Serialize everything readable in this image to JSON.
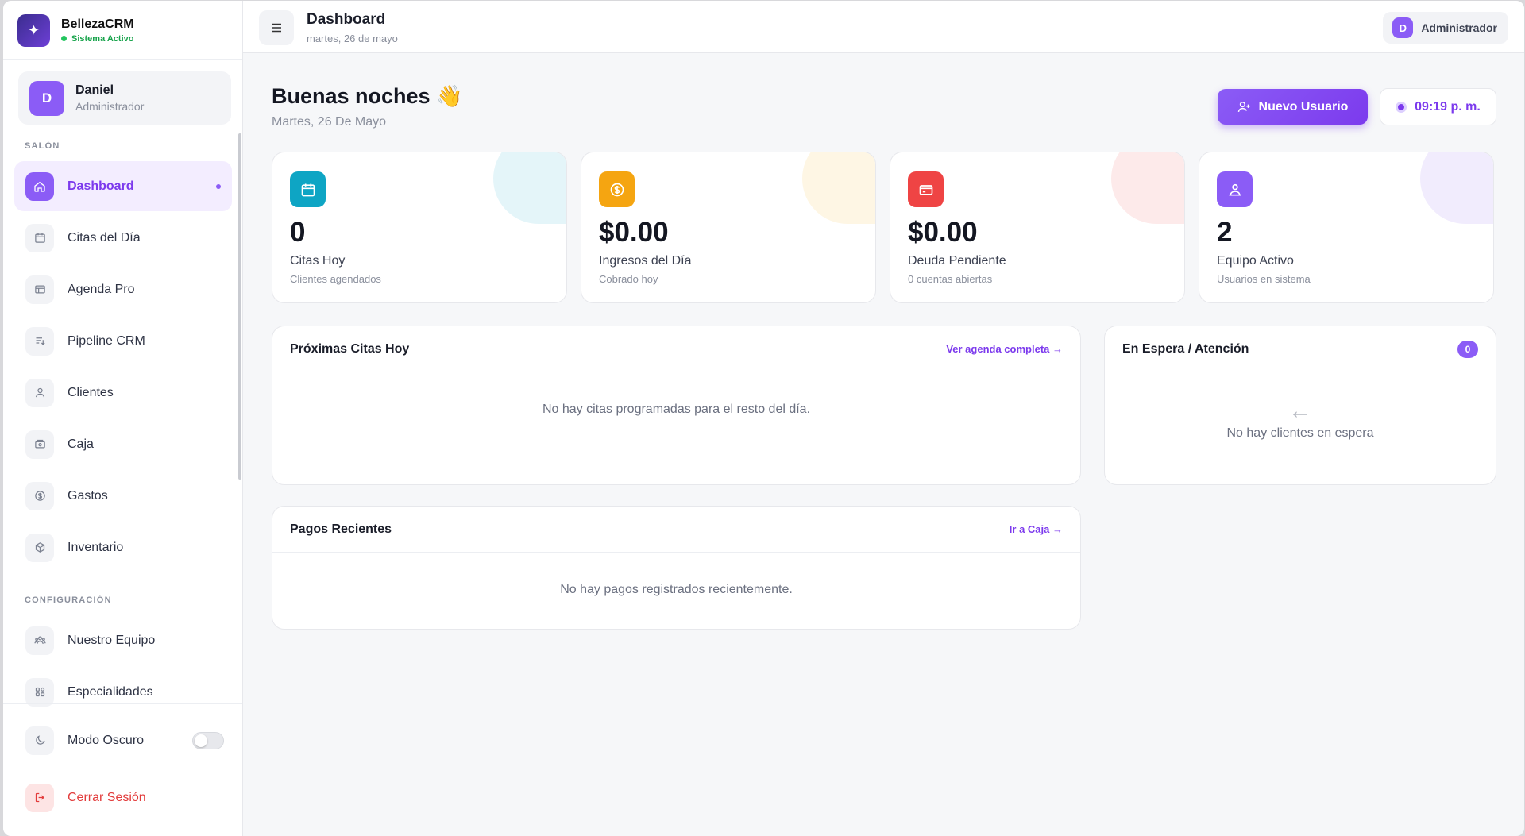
{
  "brand": {
    "name": "BellezaCRM",
    "status": "Sistema Activo"
  },
  "user": {
    "initial": "D",
    "name": "Daniel",
    "role": "Administrador"
  },
  "sidebar": {
    "section_salon": "SALÓN",
    "section_config": "CONFIGURACIÓN",
    "salon_items": [
      {
        "label": "Dashboard",
        "icon": "home-icon",
        "active": true
      },
      {
        "label": "Citas del Día",
        "icon": "calendar-icon"
      },
      {
        "label": "Agenda Pro",
        "icon": "agenda-icon"
      },
      {
        "label": "Pipeline CRM",
        "icon": "pipeline-icon"
      },
      {
        "label": "Clientes",
        "icon": "user-icon"
      },
      {
        "label": "Caja",
        "icon": "cash-icon"
      },
      {
        "label": "Gastos",
        "icon": "dollar-icon"
      },
      {
        "label": "Inventario",
        "icon": "box-icon"
      }
    ],
    "config_items": [
      {
        "label": "Nuestro Equipo",
        "icon": "team-icon"
      },
      {
        "label": "Especialidades",
        "icon": "grid-icon"
      }
    ],
    "dark_mode": {
      "label": "Modo Oscuro",
      "on": false
    },
    "logout": "Cerrar Sesión"
  },
  "header": {
    "title": "Dashboard",
    "date": "martes, 26 de mayo",
    "admin_initial": "D",
    "admin_label": "Administrador"
  },
  "main": {
    "greeting": "Buenas noches 👋",
    "date": "Martes, 26 De Mayo",
    "new_user_button": "Nuevo Usuario",
    "clock": "09:19 p. m."
  },
  "stats": [
    {
      "value": "0",
      "label": "Citas Hoy",
      "sub": "Clientes agendados",
      "icon": "calendar-icon",
      "color": "#0ea5c4",
      "blob": "#e4f5f9"
    },
    {
      "value": "$0.00",
      "label": "Ingresos del Día",
      "sub": "Cobrado hoy",
      "icon": "dollar-icon",
      "color": "#f5a511",
      "blob": "#fef6e4"
    },
    {
      "value": "$0.00",
      "label": "Deuda Pendiente",
      "sub": "0 cuentas abiertas",
      "icon": "card-icon",
      "color": "#ef4444",
      "blob": "#fdeaea"
    },
    {
      "value": "2",
      "label": "Equipo Activo",
      "sub": "Usuarios en sistema",
      "icon": "team-icon",
      "color": "#8b5cf6",
      "blob": "#f1ecfd"
    }
  ],
  "panels": {
    "upcoming": {
      "title": "Próximas Citas Hoy",
      "link": "Ver agenda completa →",
      "empty": "No hay citas programadas para el resto del día."
    },
    "waiting": {
      "title": "En Espera / Atención",
      "count": "0",
      "arrow": "←",
      "empty": "No hay clientes en espera"
    },
    "payments": {
      "title": "Pagos Recientes",
      "link": "Ir a Caja →",
      "empty": "No hay pagos registrados recientemente."
    }
  }
}
